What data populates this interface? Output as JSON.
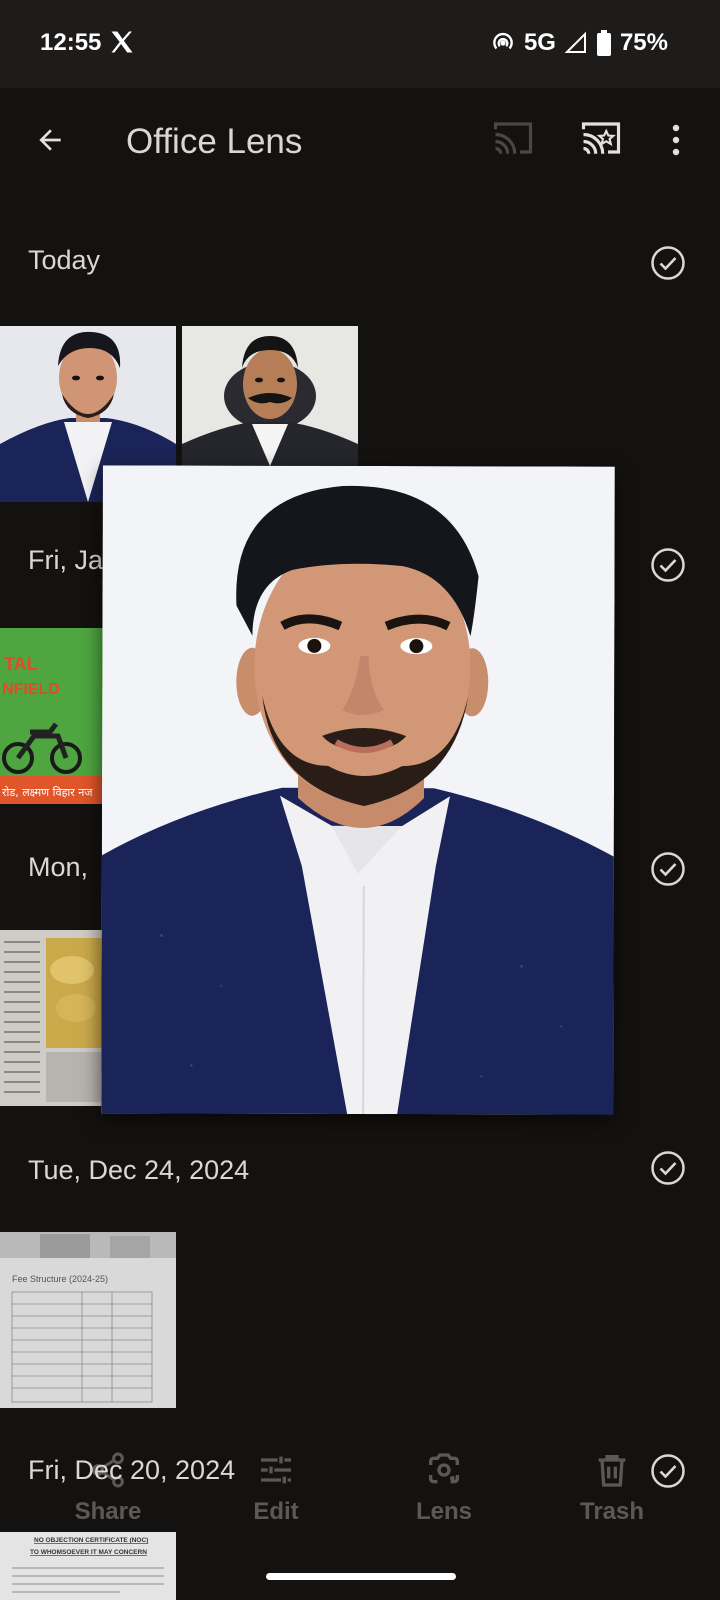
{
  "status_bar": {
    "time": "12:55",
    "network": "5G",
    "battery": "75%"
  },
  "app_bar": {
    "title": "Office Lens"
  },
  "sections": [
    {
      "title": "Today"
    },
    {
      "title": "Fri, Ja"
    },
    {
      "title": "Mon, "
    },
    {
      "title": "Tue, Dec 24, 2024"
    },
    {
      "title": "Fri, Dec 20, 2024"
    }
  ],
  "thumbnails": {
    "bike_banner": {
      "line1": "TAL",
      "line2": "NFIELD",
      "line3": "रोड, लक्ष्मण विहार नज"
    },
    "fee_doc": {
      "heading": "Fee Structure (2024-25)"
    },
    "noc_doc": {
      "line1": "NO OBJECTION CERTIFICATE (NOC)",
      "line2": "TO WHOMSOEVER IT MAY CONCERN"
    }
  },
  "bottom_bar": {
    "share": "Share",
    "edit": "Edit",
    "lens": "Lens",
    "trash": "Trash"
  },
  "colors": {
    "background": "#141210",
    "status_bar": "#1e1c1a",
    "suit": "#1b2458"
  }
}
